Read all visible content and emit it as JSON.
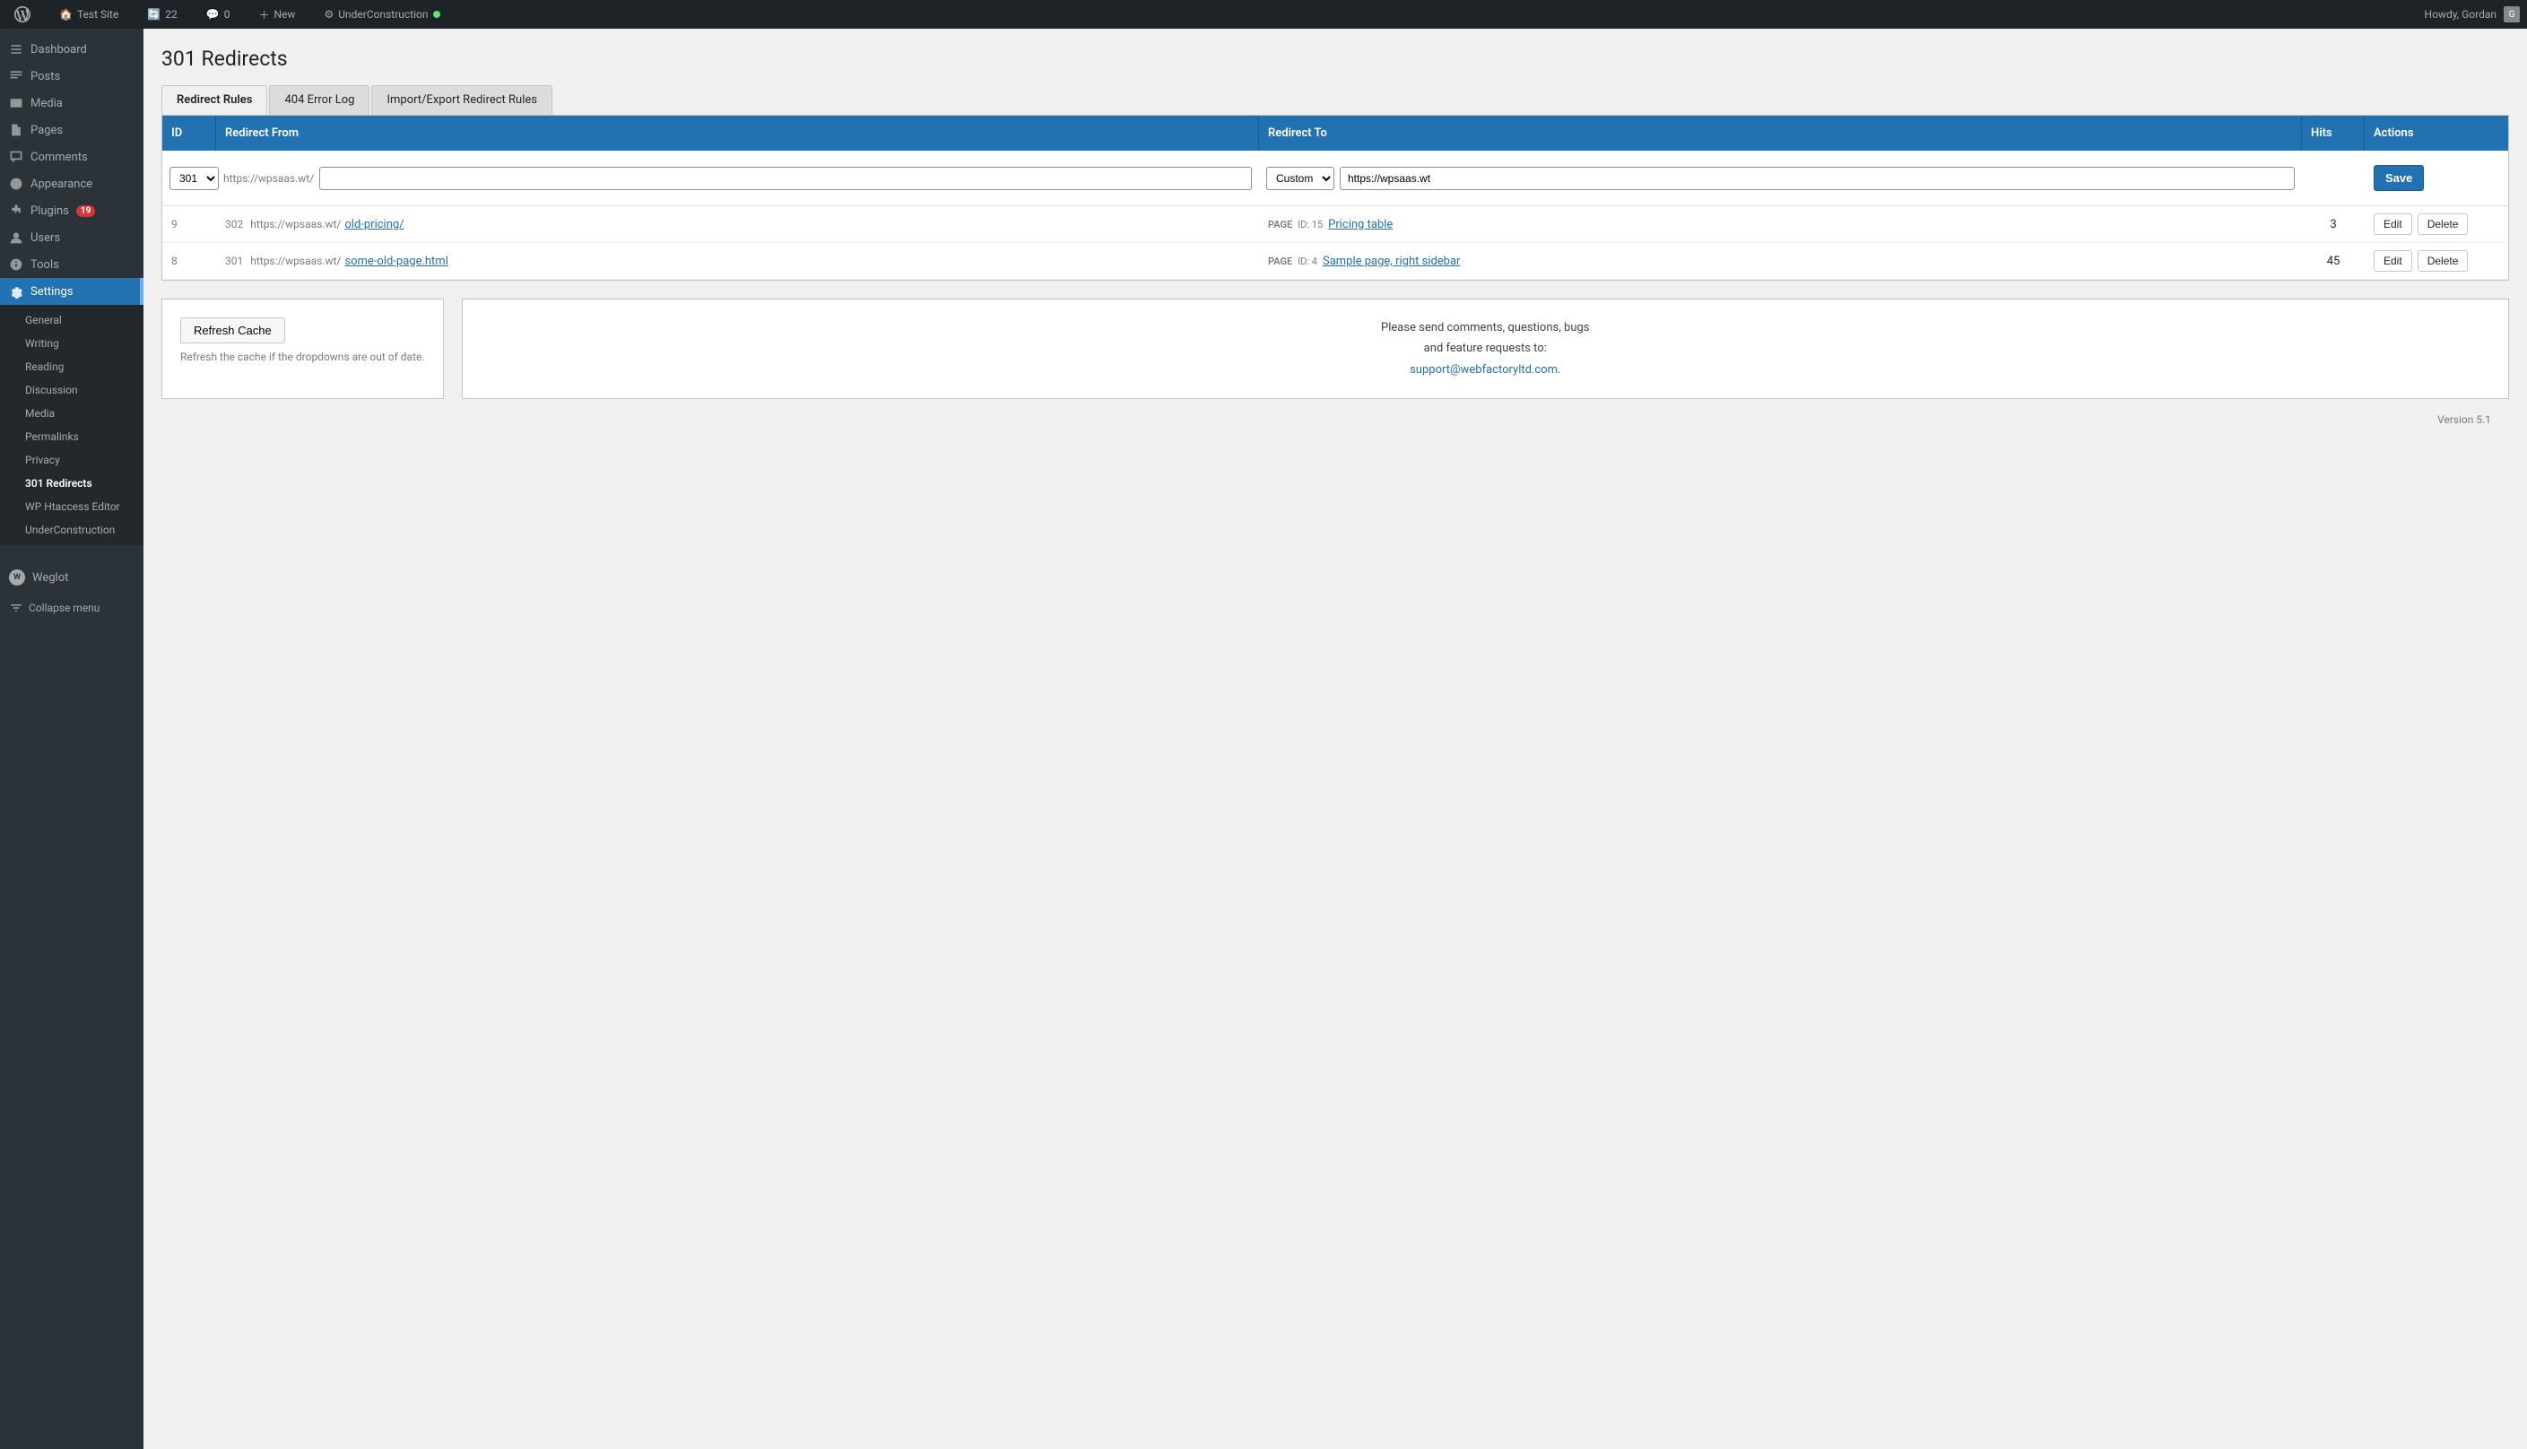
{
  "adminbar": {
    "site_name": "Test Site",
    "updates": "22",
    "comments": "0",
    "new_label": "New",
    "plugin_label": "UnderConstruction",
    "howdy": "Howdy, Gordan"
  },
  "sidebar": {
    "dashboard_label": "Dashboard",
    "posts_label": "Posts",
    "media_label": "Media",
    "pages_label": "Pages",
    "comments_label": "Comments",
    "appearance_label": "Appearance",
    "plugins_label": "Plugins",
    "plugins_badge": "19",
    "users_label": "Users",
    "tools_label": "Tools",
    "settings_label": "Settings",
    "settings_sub": {
      "general": "General",
      "writing": "Writing",
      "reading": "Reading",
      "discussion": "Discussion",
      "media": "Media",
      "permalinks": "Permalinks",
      "privacy": "Privacy",
      "redirects": "301 Redirects",
      "wp_htaccess": "WP Htaccess Editor",
      "under_construction": "UnderConstruction"
    },
    "weglot_label": "Weglot",
    "collapse_label": "Collapse menu"
  },
  "page": {
    "title": "301 Redirects",
    "tabs": [
      "Redirect Rules",
      "404 Error Log",
      "Import/Export Redirect Rules"
    ],
    "active_tab": 0
  },
  "table": {
    "columns": {
      "id": "ID",
      "redirect_from": "Redirect From",
      "redirect_to": "Redirect To",
      "hits": "Hits",
      "actions": "Actions"
    },
    "new_row": {
      "type_value": "301",
      "from_base": "https://wpsaas.wt/",
      "from_path_placeholder": "",
      "to_type_value": "Custom",
      "to_url_value": "https://wpsaas.wt",
      "save_label": "Save"
    },
    "rows": [
      {
        "id": "9",
        "code": "302",
        "from_base": "https://wpsaas.wt/",
        "from_path": "old-pricing/",
        "to_type": "PAGE",
        "to_id": "ID: 15",
        "to_target": "Pricing table",
        "hits": "3",
        "edit_label": "Edit",
        "delete_label": "Delete"
      },
      {
        "id": "8",
        "code": "301",
        "from_base": "https://wpsaas.wt/",
        "from_path": "some-old-page.html",
        "to_type": "PAGE",
        "to_id": "ID: 4",
        "to_target": "Sample page, right sidebar",
        "hits": "45",
        "edit_label": "Edit",
        "delete_label": "Delete"
      }
    ]
  },
  "refresh_cache": {
    "button_label": "Refresh Cache",
    "description": "Refresh the cache if the dropdowns are out of date."
  },
  "support": {
    "text1": "Please send comments, questions, bugs",
    "text2": "and feature requests to:",
    "email": "support@webfactoryltd.com",
    "period": "."
  },
  "footer": {
    "version": "Version 5.1"
  }
}
